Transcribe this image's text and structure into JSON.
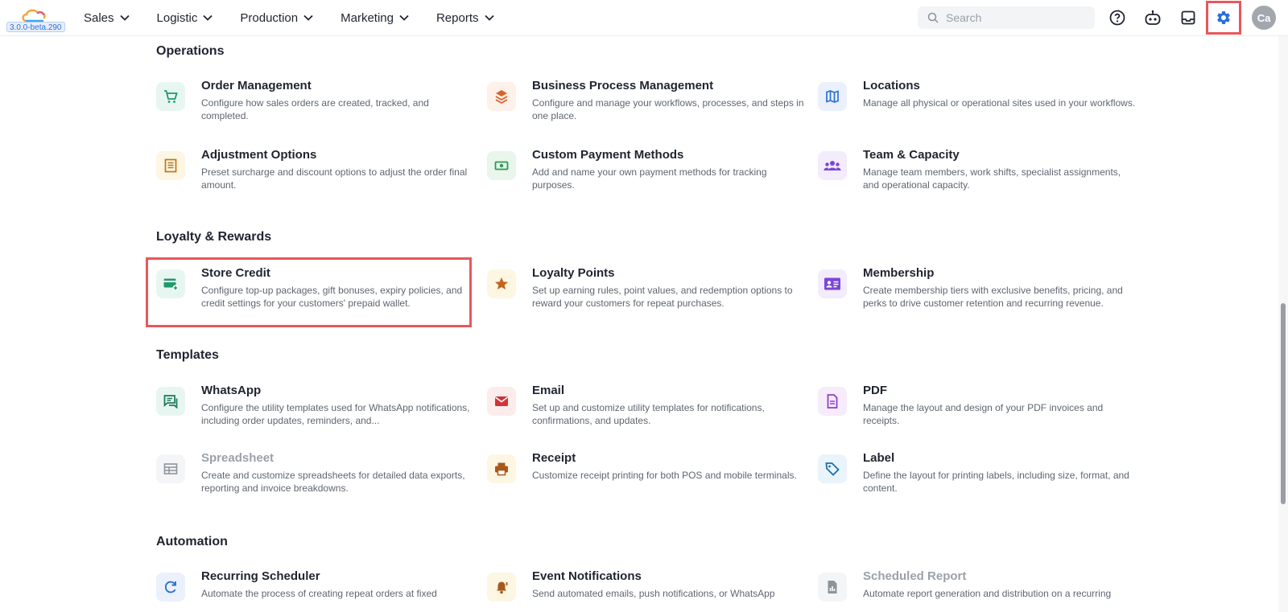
{
  "header": {
    "version": "3.0.0-beta.290",
    "nav": [
      {
        "label": "Sales",
        "icon": "chevron-down-icon"
      },
      {
        "label": "Logistic",
        "icon": "chevron-down-icon"
      },
      {
        "label": "Production",
        "icon": "chevron-down-icon"
      },
      {
        "label": "Marketing",
        "icon": "chevron-down-icon"
      },
      {
        "label": "Reports",
        "icon": "chevron-down-icon"
      }
    ],
    "search_placeholder": "Search",
    "avatar_initials": "Ca",
    "icons": [
      "help-icon",
      "robot-icon",
      "inbox-icon",
      "gear-icon"
    ]
  },
  "sections": [
    {
      "title": "Operations",
      "items": [
        {
          "title": "Order Management",
          "desc": "Configure how sales orders are created, tracked, and completed.",
          "icon": "cart-icon"
        },
        {
          "title": "Business Process Management",
          "desc": "Configure and manage your workflows, processes, and steps in one place.",
          "icon": "layers-icon"
        },
        {
          "title": "Locations",
          "desc": "Manage all physical or operational sites used in your workflows.",
          "icon": "map-icon"
        },
        {
          "title": "Adjustment Options",
          "desc": "Preset surcharge and discount options to adjust the order final amount.",
          "icon": "list-icon"
        },
        {
          "title": "Custom Payment Methods",
          "desc": "Add and name your own payment methods for tracking purposes.",
          "icon": "money-icon"
        },
        {
          "title": "Team & Capacity",
          "desc": "Manage team members, work shifts, specialist assignments, and operational capacity.",
          "icon": "team-icon"
        }
      ]
    },
    {
      "title": "Loyalty & Rewards",
      "items": [
        {
          "title": "Store Credit",
          "desc": "Configure top-up packages, gift bonuses, expiry policies, and credit settings for your customers' prepaid wallet.",
          "icon": "card-plus-icon"
        },
        {
          "title": "Loyalty Points",
          "desc": "Set up earning rules, point values, and redemption options to reward your customers for repeat purchases.",
          "icon": "star-icon"
        },
        {
          "title": "Membership",
          "desc": "Create membership tiers with exclusive benefits, pricing, and perks to drive customer retention and recurring revenue.",
          "icon": "id-card-icon"
        }
      ]
    },
    {
      "title": "Templates",
      "items": [
        {
          "title": "WhatsApp",
          "desc": "Configure the utility templates used for WhatsApp notifications, including order updates, reminders, and...",
          "icon": "chat-icon"
        },
        {
          "title": "Email",
          "desc": "Set up and customize utility templates for notifications, confirmations, and updates.",
          "icon": "mail-icon"
        },
        {
          "title": "PDF",
          "desc": "Manage the layout and design of your PDF invoices and receipts.",
          "icon": "document-icon"
        },
        {
          "title": "Spreadsheet",
          "desc": "Create and customize spreadsheets for detailed data exports, reporting and invoice breakdowns.",
          "icon": "table-icon"
        },
        {
          "title": "Receipt",
          "desc": "Customize receipt printing for both POS and mobile terminals.",
          "icon": "printer-icon"
        },
        {
          "title": "Label",
          "desc": "Define the layout for printing labels, including size, format, and content.",
          "icon": "tag-icon"
        }
      ]
    },
    {
      "title": "Automation",
      "items": [
        {
          "title": "Recurring Scheduler",
          "desc": "Automate the process of creating repeat orders at fixed",
          "icon": "refresh-icon"
        },
        {
          "title": "Event Notifications",
          "desc": "Send automated emails, push notifications, or WhatsApp",
          "icon": "bell-icon"
        },
        {
          "title": "Scheduled Report",
          "desc": "Automate report generation and distribution on a recurring",
          "icon": "report-icon"
        }
      ]
    }
  ],
  "colors": {
    "highlight": "#e8575b",
    "gear": "#2b6fd6",
    "accent_green": "#1f9a6b"
  }
}
